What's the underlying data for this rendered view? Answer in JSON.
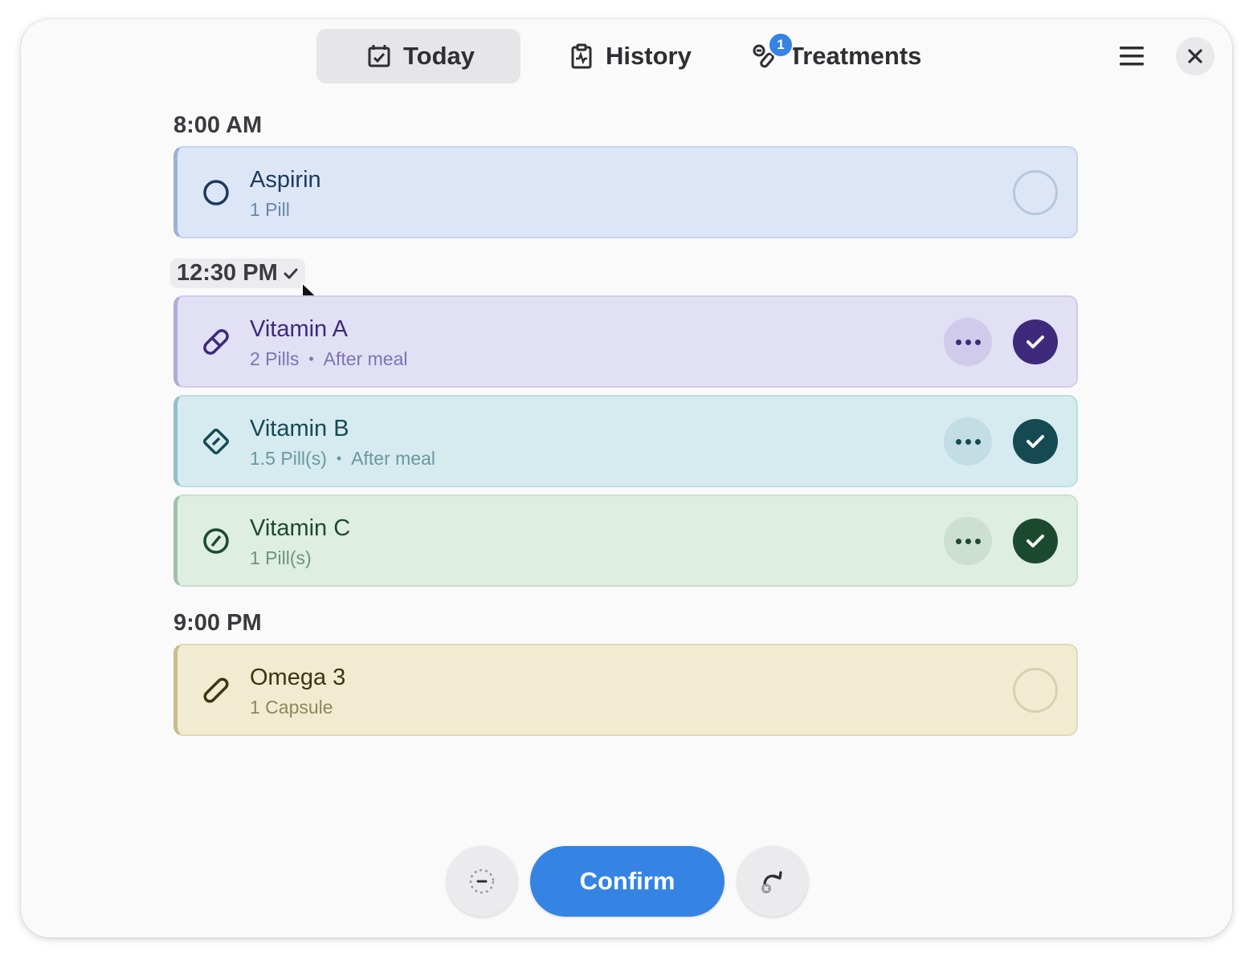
{
  "tabs": [
    {
      "label": "Today",
      "icon": "calendar-check-icon",
      "active": true
    },
    {
      "label": "History",
      "icon": "clipboard-icon"
    },
    {
      "label": "Treatments",
      "icon": "pills-icon",
      "badge": "1"
    }
  ],
  "header": {
    "menu_icon": "hamburger-menu-icon",
    "close_icon": "close-icon"
  },
  "sections": [
    {
      "time": "8:00 AM",
      "items": [
        {
          "name": "Aspirin",
          "dose": "1 Pill",
          "note": "",
          "taken": false,
          "icon": "circle-pill-icon",
          "color": "#1c3a5e"
        }
      ]
    },
    {
      "time": "12:30 PM",
      "items": [
        {
          "name": "Vitamin A",
          "dose": "2 Pills",
          "note": "After meal",
          "taken": true,
          "icon": "capsule-pill-icon",
          "color": "#3e2a7a"
        },
        {
          "name": "Vitamin B",
          "dose": "1.5 Pill(s)",
          "note": "After meal",
          "taken": true,
          "icon": "diamond-pill-icon",
          "color": "#164a52"
        },
        {
          "name": "Vitamin C",
          "dose": "1 Pill(s)",
          "note": "",
          "taken": true,
          "icon": "round-pill-icon",
          "color": "#1c4a30"
        }
      ]
    },
    {
      "time": "9:00 PM",
      "items": [
        {
          "name": "Omega 3",
          "dose": "1 Capsule",
          "note": "",
          "taken": false,
          "icon": "capsule-icon",
          "color": "#3d3410"
        }
      ]
    }
  ],
  "footer": {
    "confirm_label": "Confirm",
    "skip_icon": "skip-icon",
    "reschedule_icon": "reschedule-icon"
  }
}
